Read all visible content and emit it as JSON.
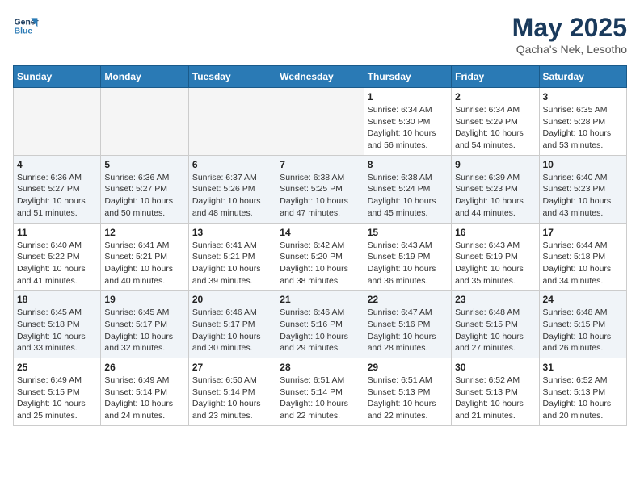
{
  "header": {
    "logo_line1": "General",
    "logo_line2": "Blue",
    "month": "May 2025",
    "location": "Qacha's Nek, Lesotho"
  },
  "weekdays": [
    "Sunday",
    "Monday",
    "Tuesday",
    "Wednesday",
    "Thursday",
    "Friday",
    "Saturday"
  ],
  "weeks": [
    [
      {
        "day": "",
        "info": ""
      },
      {
        "day": "",
        "info": ""
      },
      {
        "day": "",
        "info": ""
      },
      {
        "day": "",
        "info": ""
      },
      {
        "day": "1",
        "info": "Sunrise: 6:34 AM\nSunset: 5:30 PM\nDaylight: 10 hours\nand 56 minutes."
      },
      {
        "day": "2",
        "info": "Sunrise: 6:34 AM\nSunset: 5:29 PM\nDaylight: 10 hours\nand 54 minutes."
      },
      {
        "day": "3",
        "info": "Sunrise: 6:35 AM\nSunset: 5:28 PM\nDaylight: 10 hours\nand 53 minutes."
      }
    ],
    [
      {
        "day": "4",
        "info": "Sunrise: 6:36 AM\nSunset: 5:27 PM\nDaylight: 10 hours\nand 51 minutes."
      },
      {
        "day": "5",
        "info": "Sunrise: 6:36 AM\nSunset: 5:27 PM\nDaylight: 10 hours\nand 50 minutes."
      },
      {
        "day": "6",
        "info": "Sunrise: 6:37 AM\nSunset: 5:26 PM\nDaylight: 10 hours\nand 48 minutes."
      },
      {
        "day": "7",
        "info": "Sunrise: 6:38 AM\nSunset: 5:25 PM\nDaylight: 10 hours\nand 47 minutes."
      },
      {
        "day": "8",
        "info": "Sunrise: 6:38 AM\nSunset: 5:24 PM\nDaylight: 10 hours\nand 45 minutes."
      },
      {
        "day": "9",
        "info": "Sunrise: 6:39 AM\nSunset: 5:23 PM\nDaylight: 10 hours\nand 44 minutes."
      },
      {
        "day": "10",
        "info": "Sunrise: 6:40 AM\nSunset: 5:23 PM\nDaylight: 10 hours\nand 43 minutes."
      }
    ],
    [
      {
        "day": "11",
        "info": "Sunrise: 6:40 AM\nSunset: 5:22 PM\nDaylight: 10 hours\nand 41 minutes."
      },
      {
        "day": "12",
        "info": "Sunrise: 6:41 AM\nSunset: 5:21 PM\nDaylight: 10 hours\nand 40 minutes."
      },
      {
        "day": "13",
        "info": "Sunrise: 6:41 AM\nSunset: 5:21 PM\nDaylight: 10 hours\nand 39 minutes."
      },
      {
        "day": "14",
        "info": "Sunrise: 6:42 AM\nSunset: 5:20 PM\nDaylight: 10 hours\nand 38 minutes."
      },
      {
        "day": "15",
        "info": "Sunrise: 6:43 AM\nSunset: 5:19 PM\nDaylight: 10 hours\nand 36 minutes."
      },
      {
        "day": "16",
        "info": "Sunrise: 6:43 AM\nSunset: 5:19 PM\nDaylight: 10 hours\nand 35 minutes."
      },
      {
        "day": "17",
        "info": "Sunrise: 6:44 AM\nSunset: 5:18 PM\nDaylight: 10 hours\nand 34 minutes."
      }
    ],
    [
      {
        "day": "18",
        "info": "Sunrise: 6:45 AM\nSunset: 5:18 PM\nDaylight: 10 hours\nand 33 minutes."
      },
      {
        "day": "19",
        "info": "Sunrise: 6:45 AM\nSunset: 5:17 PM\nDaylight: 10 hours\nand 32 minutes."
      },
      {
        "day": "20",
        "info": "Sunrise: 6:46 AM\nSunset: 5:17 PM\nDaylight: 10 hours\nand 30 minutes."
      },
      {
        "day": "21",
        "info": "Sunrise: 6:46 AM\nSunset: 5:16 PM\nDaylight: 10 hours\nand 29 minutes."
      },
      {
        "day": "22",
        "info": "Sunrise: 6:47 AM\nSunset: 5:16 PM\nDaylight: 10 hours\nand 28 minutes."
      },
      {
        "day": "23",
        "info": "Sunrise: 6:48 AM\nSunset: 5:15 PM\nDaylight: 10 hours\nand 27 minutes."
      },
      {
        "day": "24",
        "info": "Sunrise: 6:48 AM\nSunset: 5:15 PM\nDaylight: 10 hours\nand 26 minutes."
      }
    ],
    [
      {
        "day": "25",
        "info": "Sunrise: 6:49 AM\nSunset: 5:15 PM\nDaylight: 10 hours\nand 25 minutes."
      },
      {
        "day": "26",
        "info": "Sunrise: 6:49 AM\nSunset: 5:14 PM\nDaylight: 10 hours\nand 24 minutes."
      },
      {
        "day": "27",
        "info": "Sunrise: 6:50 AM\nSunset: 5:14 PM\nDaylight: 10 hours\nand 23 minutes."
      },
      {
        "day": "28",
        "info": "Sunrise: 6:51 AM\nSunset: 5:14 PM\nDaylight: 10 hours\nand 22 minutes."
      },
      {
        "day": "29",
        "info": "Sunrise: 6:51 AM\nSunset: 5:13 PM\nDaylight: 10 hours\nand 22 minutes."
      },
      {
        "day": "30",
        "info": "Sunrise: 6:52 AM\nSunset: 5:13 PM\nDaylight: 10 hours\nand 21 minutes."
      },
      {
        "day": "31",
        "info": "Sunrise: 6:52 AM\nSunset: 5:13 PM\nDaylight: 10 hours\nand 20 minutes."
      }
    ]
  ]
}
